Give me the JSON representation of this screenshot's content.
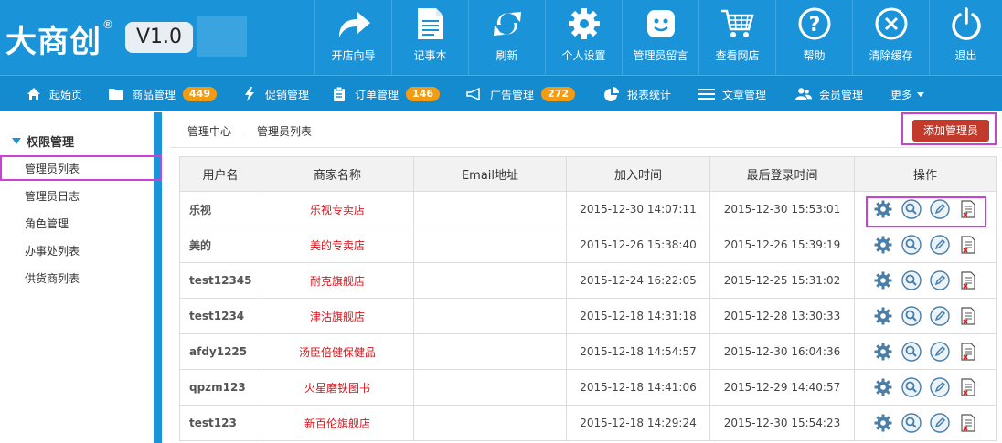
{
  "brand": {
    "logo_text": "大商创",
    "registered": "®",
    "version": "V1.0"
  },
  "toolbar": [
    {
      "label": "开店向导",
      "icon": "share-arrow-icon"
    },
    {
      "label": "记事本",
      "icon": "notepad-icon"
    },
    {
      "label": "刷新",
      "icon": "refresh-icon"
    },
    {
      "label": "个人设置",
      "icon": "gear-icon"
    },
    {
      "label": "管理员留言",
      "icon": "smiley-message-icon"
    },
    {
      "label": "查看网店",
      "icon": "cart-icon"
    },
    {
      "label": "帮助",
      "icon": "help-icon"
    },
    {
      "label": "清除缓存",
      "icon": "clear-x-icon"
    },
    {
      "label": "退出",
      "icon": "power-icon"
    }
  ],
  "nav": [
    {
      "label": "起始页",
      "icon": "home-icon"
    },
    {
      "label": "商品管理",
      "icon": "folder-icon",
      "badge": "449"
    },
    {
      "label": "促销管理",
      "icon": "lightning-icon"
    },
    {
      "label": "订单管理",
      "icon": "clipboard-icon",
      "badge": "146"
    },
    {
      "label": "广告管理",
      "icon": "megaphone-icon",
      "badge": "272"
    },
    {
      "label": "报表统计",
      "icon": "pie-chart-icon"
    },
    {
      "label": "文章管理",
      "icon": "list-icon"
    },
    {
      "label": "会员管理",
      "icon": "users-icon"
    },
    {
      "label": "更多",
      "icon": "chevron-down-icon"
    }
  ],
  "sidebar": {
    "title": "权限管理",
    "items": [
      "管理员列表",
      "管理员日志",
      "角色管理",
      "办事处列表",
      "供货商列表"
    ]
  },
  "breadcrumb": {
    "root": "管理中心",
    "separator": "-",
    "current": "管理员列表"
  },
  "add_button": "添加管理员",
  "table": {
    "headers": [
      "用户名",
      "商家名称",
      "Email地址",
      "加入时间",
      "最后登录时间",
      "操作"
    ],
    "rows": [
      {
        "username": "乐视",
        "shop": "乐视专卖店",
        "email": "",
        "joined": "2015-12-30 14:07:11",
        "last_login": "2015-12-30 15:53:01"
      },
      {
        "username": "美的",
        "shop": "美的专卖店",
        "email": "",
        "joined": "2015-12-26 15:38:40",
        "last_login": "2015-12-26 15:39:19"
      },
      {
        "username": "test12345",
        "shop": "耐克旗舰店",
        "email": "",
        "joined": "2015-12-24 16:22:05",
        "last_login": "2015-12-25 15:31:02"
      },
      {
        "username": "test1234",
        "shop": "津沽旗舰店",
        "email": "",
        "joined": "2015-12-18 14:31:18",
        "last_login": "2015-12-28 13:30:33"
      },
      {
        "username": "afdy1225",
        "shop": "汤臣倍健保健品",
        "email": "",
        "joined": "2015-12-18 14:54:57",
        "last_login": "2015-12-30 16:04:36"
      },
      {
        "username": "qpzm123",
        "shop": "火星磨铁图书",
        "email": "",
        "joined": "2015-12-18 14:41:06",
        "last_login": "2015-12-29 14:40:57"
      },
      {
        "username": "test123",
        "shop": "新百伦旗舰店",
        "email": "",
        "joined": "2015-12-18 14:29:24",
        "last_login": "2015-12-30 15:54:23"
      }
    ],
    "row_actions": [
      "settings-icon",
      "view-icon",
      "edit-icon",
      "delete-icon"
    ]
  },
  "colors": {
    "header_blue": "#1a93d8",
    "nav_blue": "#148bcf",
    "badge_orange": "#f39c12",
    "add_button_red": "#c23a2b",
    "shop_red": "#d9141c",
    "highlight_magenta": "#c744d3"
  }
}
